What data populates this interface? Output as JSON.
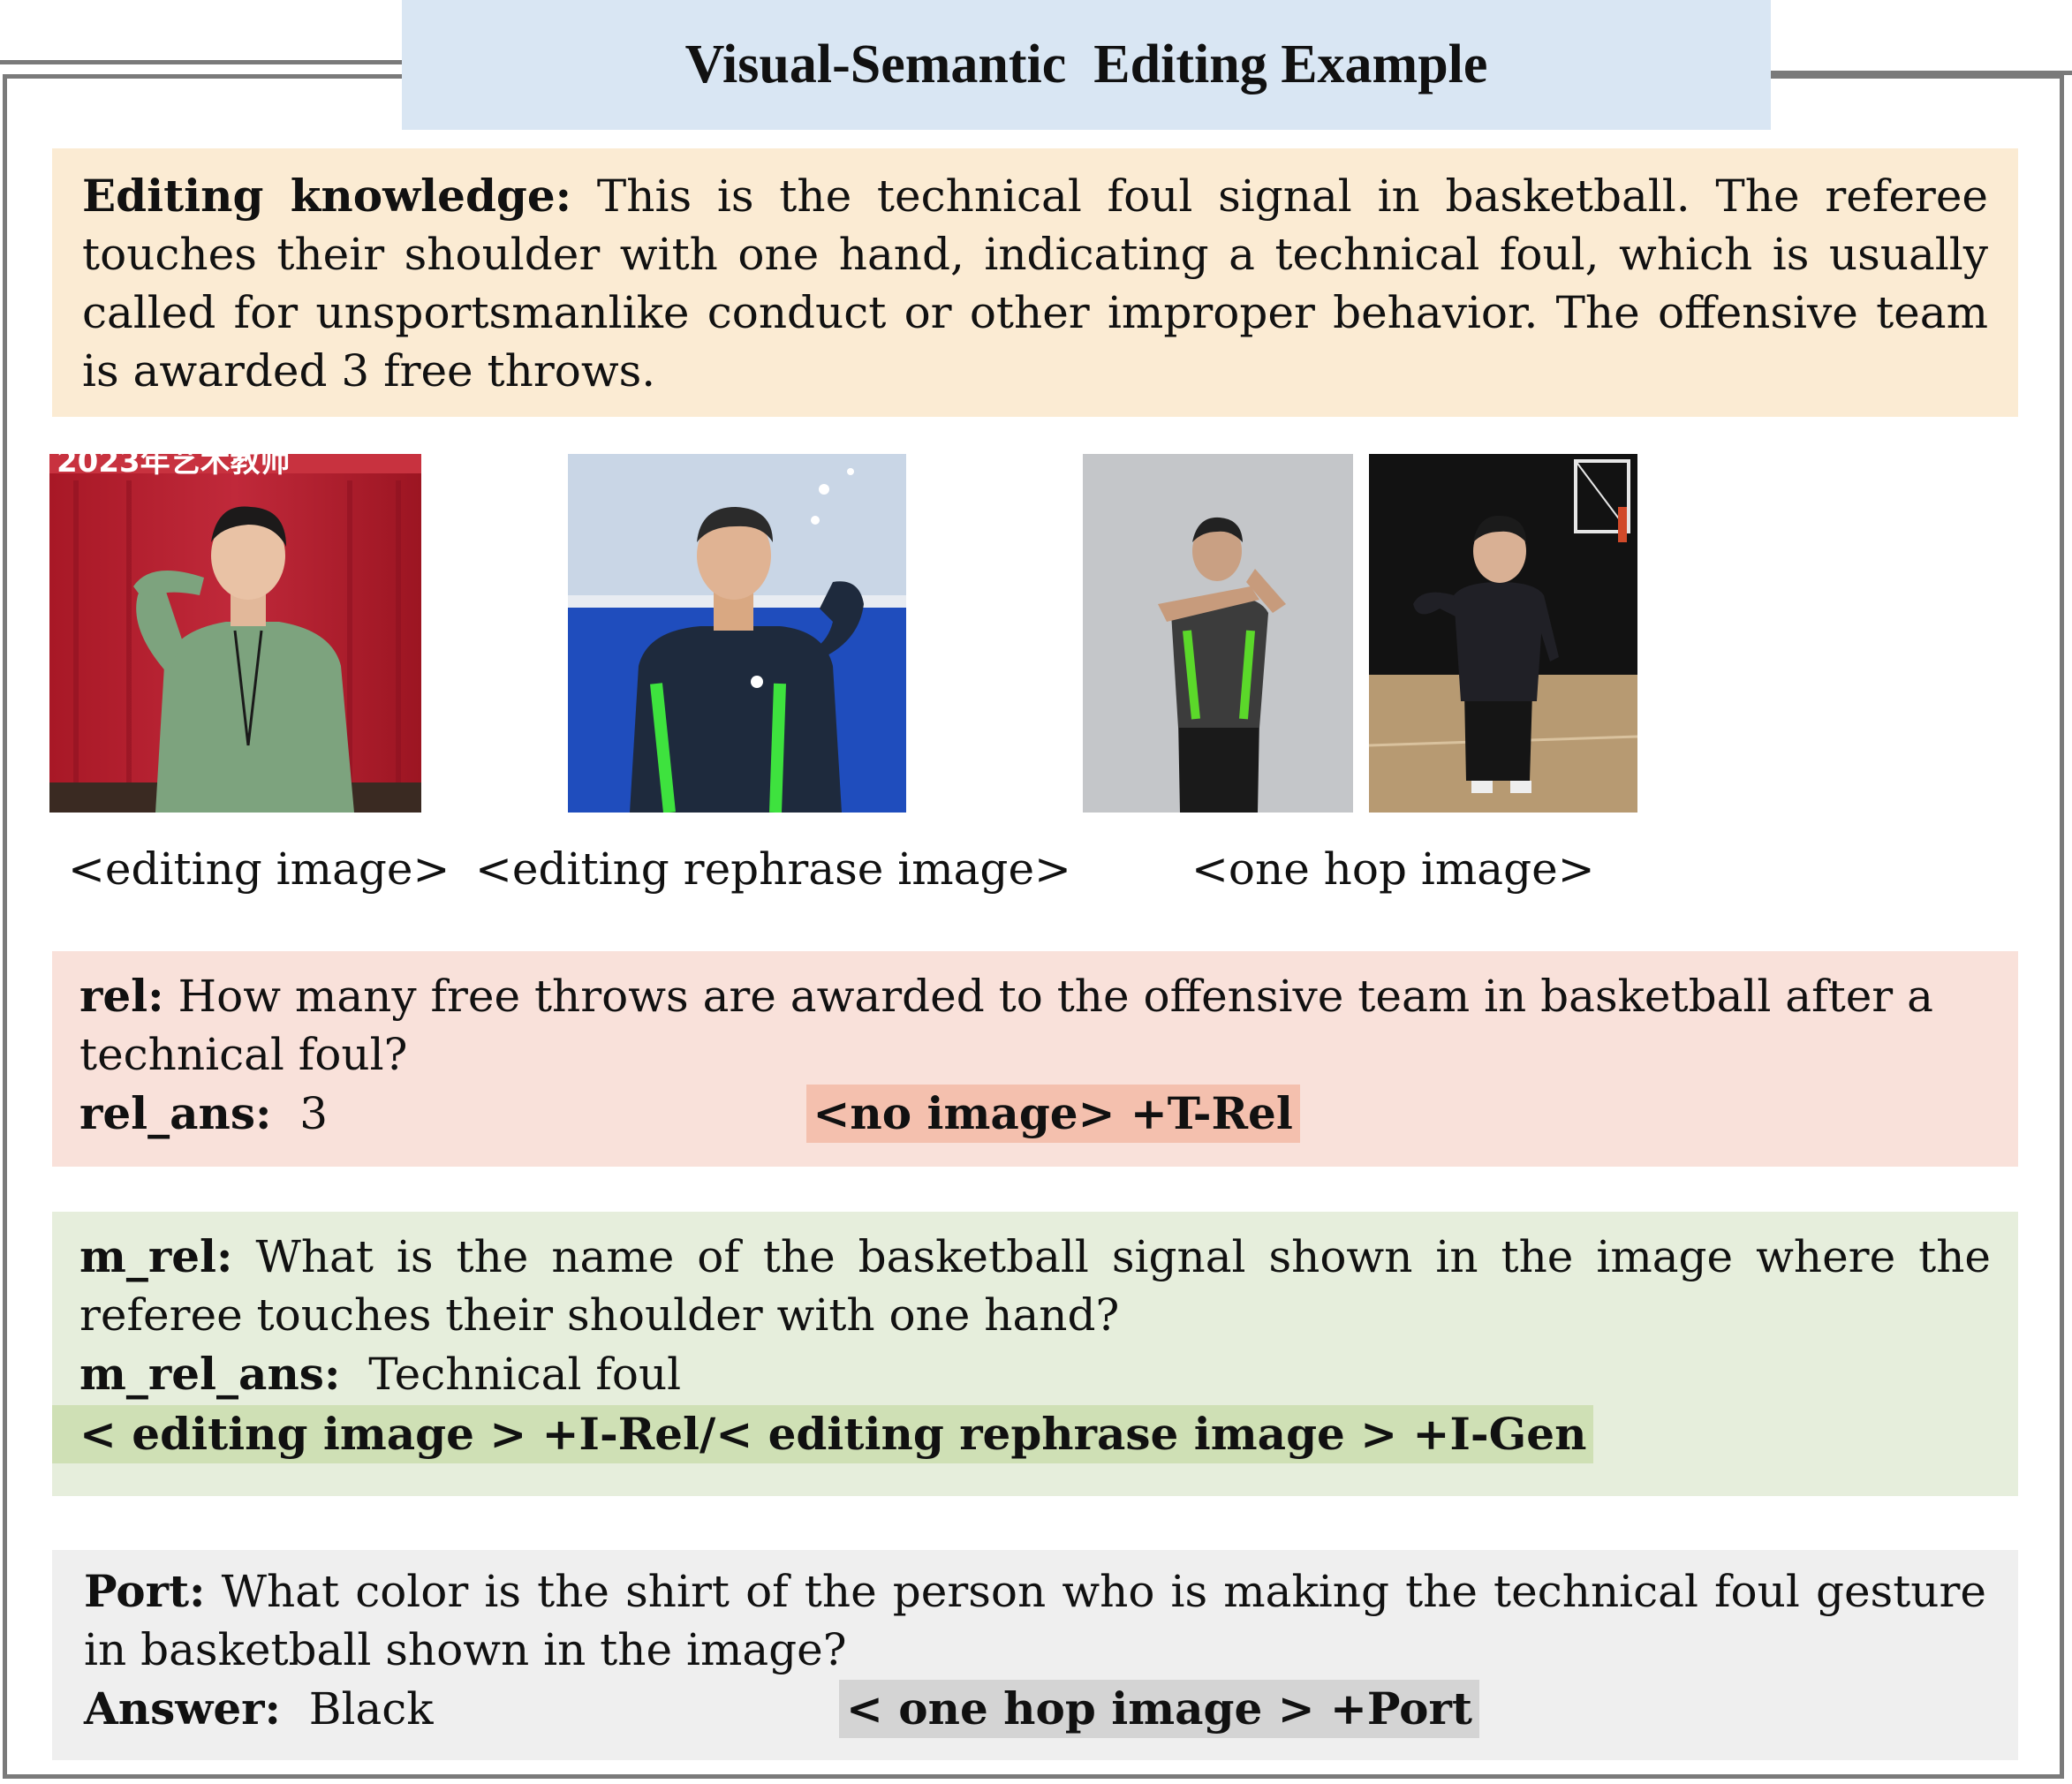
{
  "title": "Visual-Semantic  Editing Example",
  "knowledge": {
    "label": "Editing knowledge:",
    "text": " This is the technical foul signal in basketball. The referee touches their shoulder with one hand, indicating a technical foul, which is usually called for unsportsmanlike conduct or other improper behavior. The offensive team is awarded 3 free throws."
  },
  "images": {
    "banner_text": "2023年艺术教师",
    "captions": [
      "<editing image>",
      "<editing rephrase image>",
      "<one hop image>"
    ]
  },
  "rel": {
    "label": "rel:",
    "question": "  How many free throws are awarded to the offensive team in basketball after a technical foul?",
    "ans_label": "rel_ans:",
    "ans": "  3",
    "tag": "<no image> +T-Rel"
  },
  "m_rel": {
    "label": "m_rel:",
    "question": "  What is the name of the basketball signal shown in the image where the referee touches their shoulder with one hand?",
    "ans_label": "m_rel_ans:",
    "ans": "  Technical foul",
    "tag": "< editing image > +I-Rel/< editing rephrase image > +I-Gen"
  },
  "port": {
    "label": "Port:",
    "question": "  What color is the shirt of the person who is making the technical foul gesture in basketball shown in the image?",
    "ans_label": "Answer:",
    "ans": "  Black",
    "tag": "< one hop image > +Port"
  }
}
